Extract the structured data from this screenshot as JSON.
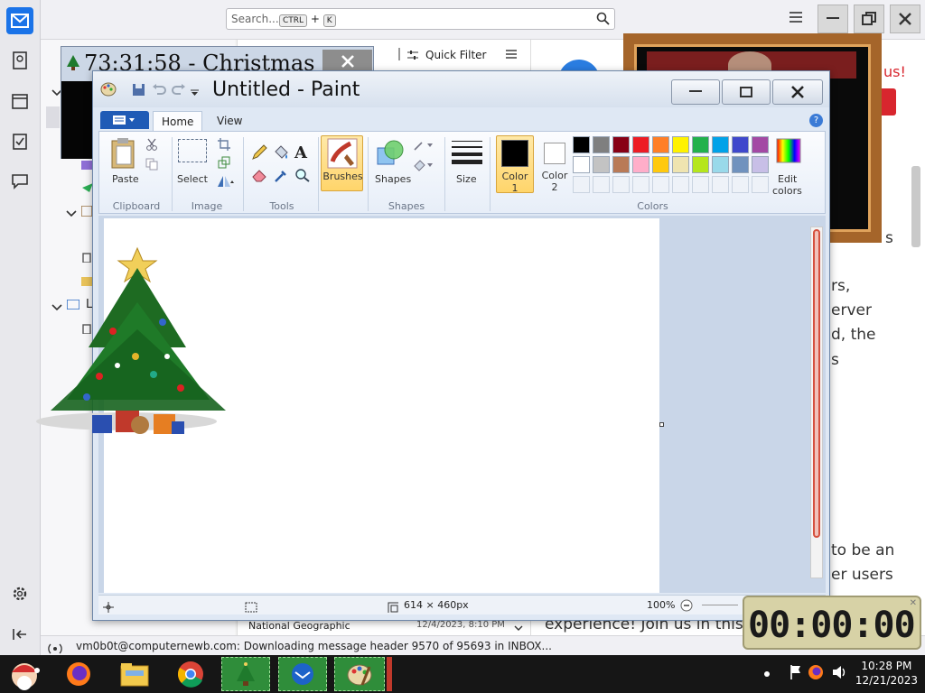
{
  "thunderbird": {
    "search_placeholder": "Search...",
    "shortcut_key1": "CTRL",
    "shortcut_plus": "+",
    "shortcut_key2": "K",
    "quick_filter": "Quick Filter",
    "folder_letter": "L",
    "list_row": {
      "sender": "National Geographic",
      "date": "12/4/2023, 8:10 PM"
    },
    "status_text": "vm0b0t@computernewb.com: Downloading message header 9570 of 95693 in INBOX...",
    "reader_lines": [
      "s",
      "rs,",
      "erver",
      "d, the",
      "s",
      "to be an",
      "er users",
      "experience! Join us in this c"
    ],
    "reader_exclaim": "us!"
  },
  "clock_window": {
    "title": "73:31:58 - Christmas"
  },
  "paint": {
    "title": "Untitled - Paint",
    "tabs": {
      "home": "Home",
      "view": "View"
    },
    "ribbon": {
      "paste": "Paste",
      "select": "Select",
      "brushes": "Brushes",
      "shapes": "Shapes",
      "size": "Size",
      "color1_line1": "Color",
      "color1_line2": "1",
      "color2_line1": "Color",
      "color2_line2": "2",
      "edit_colors_line1": "Edit",
      "edit_colors_line2": "colors",
      "groups": {
        "clipboard": "Clipboard",
        "image": "Image",
        "tools": "Tools",
        "shapes": "Shapes",
        "colors": "Colors"
      }
    },
    "palette_row1": [
      "#000000",
      "#7f7f7f",
      "#880015",
      "#ed1c24",
      "#ff7f27",
      "#fff200",
      "#22b14c",
      "#00a2e8",
      "#3f48cc",
      "#a349a4"
    ],
    "palette_row2": [
      "#ffffff",
      "#c3c3c3",
      "#b97a57",
      "#ffaec9",
      "#ffc90e",
      "#efe4b0",
      "#b5e61d",
      "#99d9ea",
      "#7092be",
      "#c8bfe7"
    ],
    "status": {
      "dimensions": "614 × 460px",
      "zoom": "100%"
    }
  },
  "stopwatch": {
    "time": "00:00:00"
  },
  "taskbar": {
    "time": "10:28 PM",
    "date": "12/21/2023"
  }
}
